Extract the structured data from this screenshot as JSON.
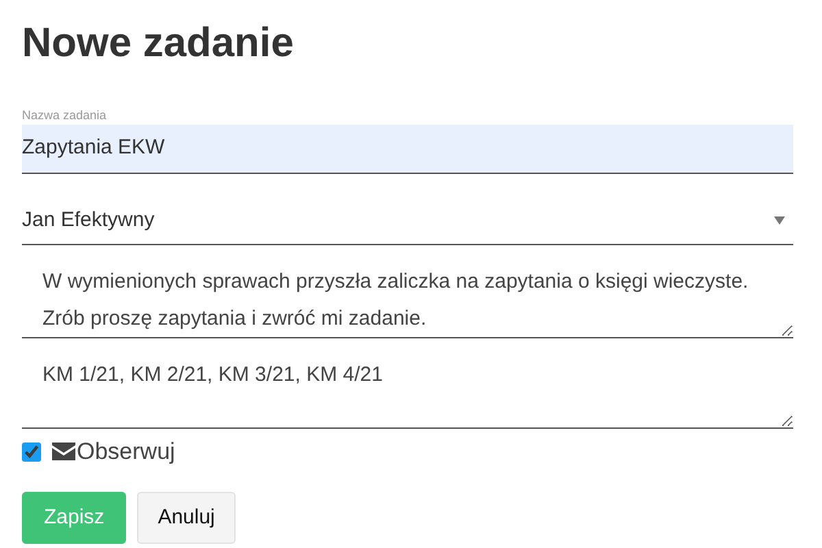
{
  "title": "Nowe zadanie",
  "name_field": {
    "label": "Nazwa zadania",
    "value": "Zapytania EKW",
    "autofilled": true
  },
  "assignee_select": {
    "value": "Jan Efektywny"
  },
  "description": {
    "value": "W wymienionych sprawach przyszła zaliczka na zapytania o księgi wieczyste. Zrób proszę zapytania i zwróć mi zadanie."
  },
  "cases": {
    "value": "KM 1/21, KM 2/21, KM 3/21, KM 4/21"
  },
  "observe": {
    "label": "Obserwuj",
    "checked": true
  },
  "buttons": [
    {
      "label": "Zapisz",
      "kind": "primary"
    },
    {
      "label": "Anuluj",
      "kind": "secondary"
    }
  ]
}
